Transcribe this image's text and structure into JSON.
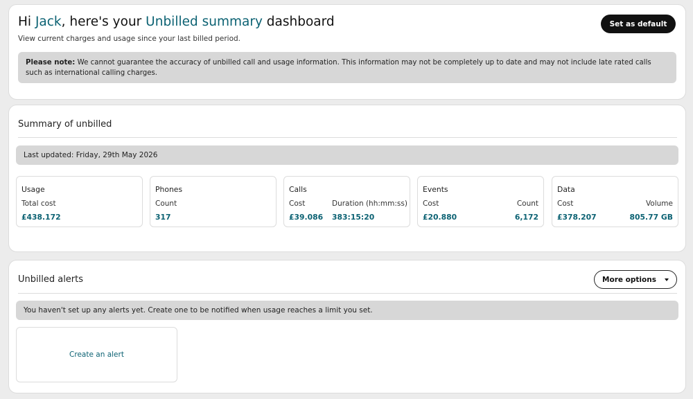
{
  "header": {
    "greeting_prefix": "Hi ",
    "user_name": "Jack",
    "greeting_mid": ", here's your ",
    "page_name": "Unbilled summary",
    "greeting_suffix": " dashboard",
    "subtext": "View current charges and usage since your last billed period.",
    "set_default_label": "Set as default",
    "note_bold": "Please note:",
    "note_text": " We cannot guarantee the accuracy of unbilled call and usage information. This information may not be completely up to date and may not include late rated calls such as international calling charges."
  },
  "summary": {
    "title": "Summary of unbilled",
    "last_updated": "Last updated: Friday, 29th May 2026",
    "cards": {
      "usage": {
        "title": "Usage",
        "label1": "Total cost",
        "value1": "£438.172"
      },
      "phones": {
        "title": "Phones",
        "label1": "Count",
        "value1": "317"
      },
      "calls": {
        "title": "Calls",
        "label1": "Cost",
        "value1": "£39.086",
        "label2": "Duration (hh:mm:ss)",
        "value2": "383:15:20"
      },
      "events": {
        "title": "Events",
        "label1": "Cost",
        "value1": "£20.880",
        "label2": "Count",
        "value2": "6,172"
      },
      "data": {
        "title": "Data",
        "label1": "Cost",
        "value1": "£378.207",
        "label2": "Volume",
        "value2": "805.77 GB"
      }
    }
  },
  "alerts": {
    "title": "Unbilled alerts",
    "more_options_label": "More options",
    "empty_message": "You haven't set up any alerts yet. Create one to be notified when usage reaches a limit you set.",
    "create_label": "Create an alert"
  },
  "colors": {
    "accent": "#0c6273",
    "button_dark": "#111111",
    "info_bar": "#d7d7d7",
    "page_bg": "#ececec"
  },
  "icons": {
    "more_options": "caret-down-icon"
  }
}
